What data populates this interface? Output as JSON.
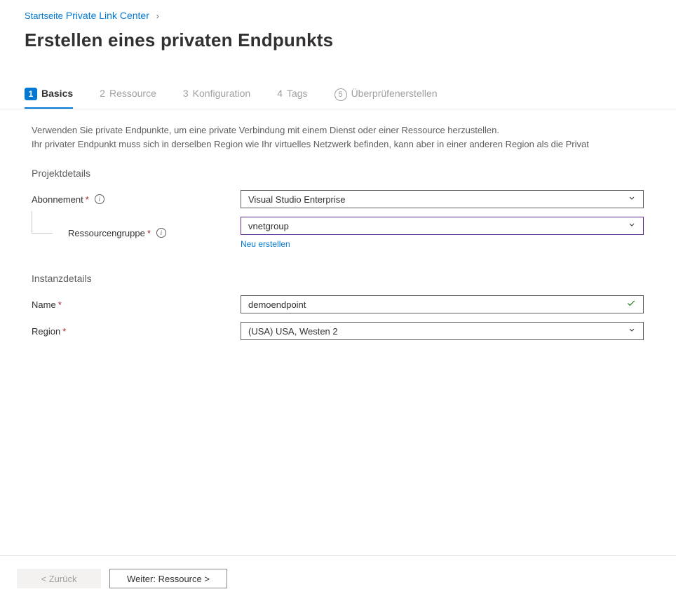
{
  "breadcrumb": {
    "home": "Startseite",
    "link": "Private Link Center"
  },
  "page_title": "Erstellen eines privaten Endpunkts",
  "tabs": {
    "basics": {
      "num": "1",
      "label": "Basics"
    },
    "resource": {
      "num": "2",
      "label": "Ressource"
    },
    "config": {
      "num": "3",
      "label": "Konfiguration"
    },
    "tags": {
      "num": "4",
      "label": "Tags"
    },
    "review": {
      "num": "5",
      "label": "Überprüfenerstellen"
    }
  },
  "description": {
    "line1": "Verwenden Sie private Endpunkte, um eine private Verbindung mit einem Dienst oder einer Ressource herzustellen.",
    "line2": "Ihr privater Endpunkt muss sich in derselben Region wie Ihr virtuelles Netzwerk befinden, kann aber in einer anderen Region als die Privat"
  },
  "sections": {
    "project": "Projektdetails",
    "instance": "Instanzdetails"
  },
  "fields": {
    "subscription": {
      "label": "Abonnement",
      "required": "*",
      "value": "Visual Studio Enterprise"
    },
    "resource_group": {
      "label": "Ressourcengruppe",
      "required": "*",
      "value": "vnetgroup",
      "create_new": "Neu erstellen"
    },
    "name": {
      "label": "Name",
      "required": "*",
      "value": "demoendpoint"
    },
    "region": {
      "label": "Region",
      "required": "*",
      "value": "(USA) USA, Westen 2"
    }
  },
  "footer": {
    "back": "<  Zurück",
    "next": "Weiter:  Ressource >"
  }
}
